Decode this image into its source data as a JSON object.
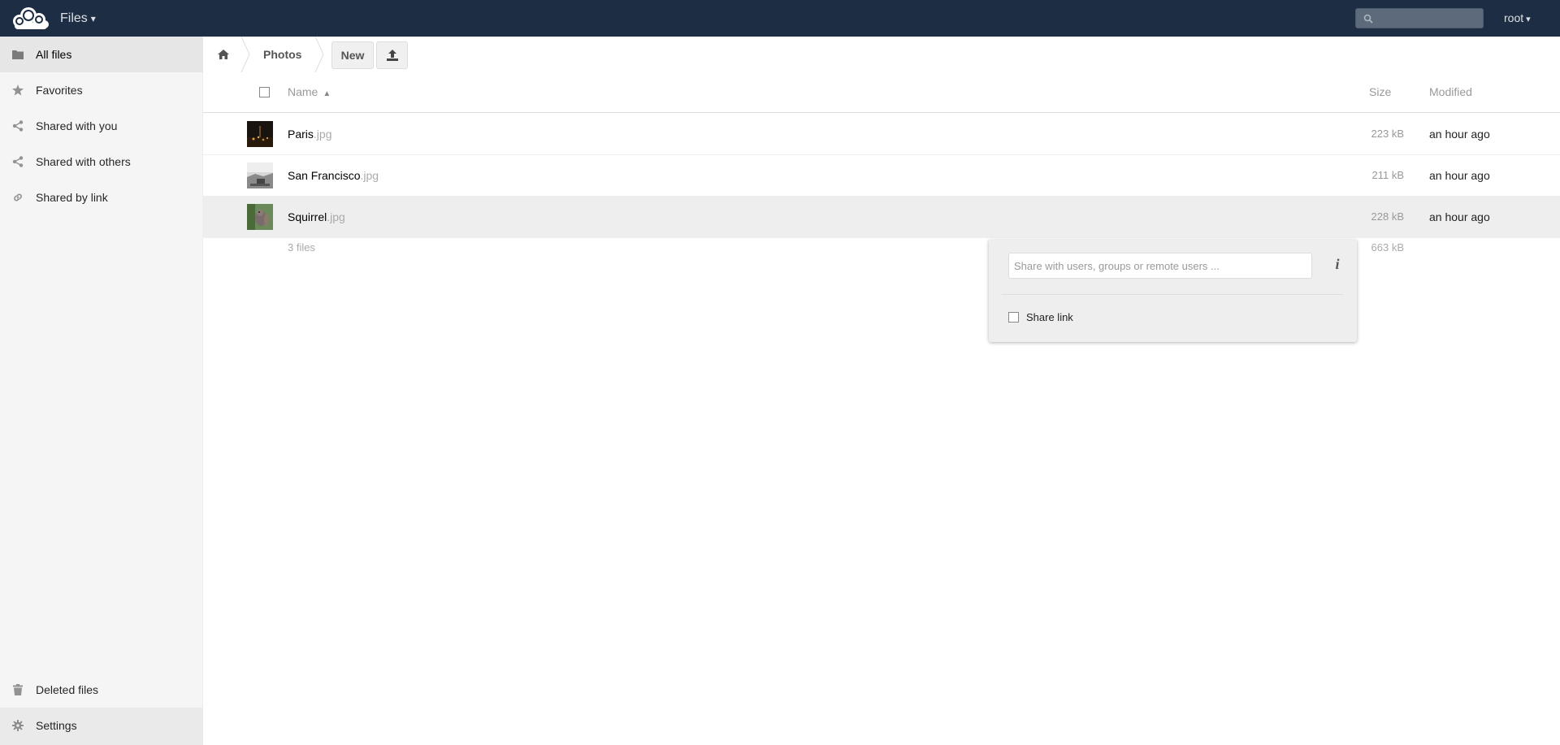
{
  "header": {
    "app_name": "Files",
    "app_caret": "▾",
    "search_placeholder": "",
    "user": "root",
    "user_caret": "▾"
  },
  "sidebar": {
    "items": [
      {
        "label": "All files",
        "icon": "folder-icon"
      },
      {
        "label": "Favorites",
        "icon": "star-icon"
      },
      {
        "label": "Shared with you",
        "icon": "share-icon"
      },
      {
        "label": "Shared with others",
        "icon": "share-icon"
      },
      {
        "label": "Shared by link",
        "icon": "link-icon"
      }
    ],
    "deleted_files": "Deleted files",
    "settings": "Settings"
  },
  "controls": {
    "breadcrumb_current": "Photos",
    "new_label": "New"
  },
  "file_list": {
    "columns": {
      "name": "Name",
      "sort_indicator": "▲",
      "size": "Size",
      "modified": "Modified"
    },
    "files": [
      {
        "basename": "Paris",
        "ext": ".jpg",
        "size": "223 kB",
        "modified": "an hour ago"
      },
      {
        "basename": "San Francisco",
        "ext": ".jpg",
        "size": "211 kB",
        "modified": "an hour ago"
      },
      {
        "basename": "Squirrel",
        "ext": ".jpg",
        "size": "228 kB",
        "modified": "an hour ago"
      }
    ],
    "summary_count": "3 files",
    "summary_size": "663 kB"
  },
  "share_dropdown": {
    "input_placeholder": "Share with users, groups or remote users ...",
    "info_label": "i",
    "share_link_label": "Share link"
  },
  "colors": {
    "header_bg": "#1d2d44",
    "sidebar_bg": "#f5f5f5",
    "selected_row_bg": "#eeeeee"
  }
}
